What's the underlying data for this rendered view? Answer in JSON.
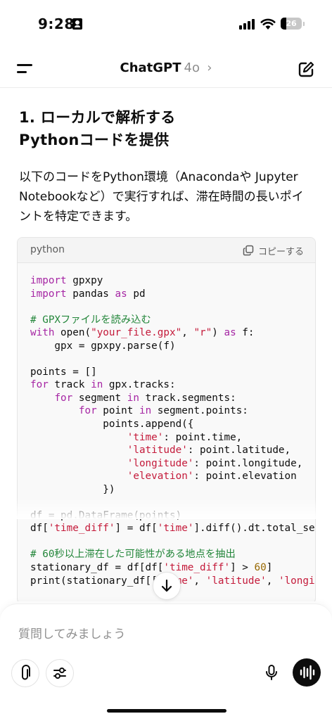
{
  "status": {
    "time": "9:28",
    "battery": "26",
    "battery_level": 0.26
  },
  "header": {
    "title": "ChatGPT",
    "model": "4o",
    "chevron": "›"
  },
  "content": {
    "heading_line1": "1. ローカルで解析する",
    "heading_line2": "Pythonコードを提供",
    "paragraph": "以下のコードをPython環境（Anacondaや Jupyter Notebookなど）で実行すれば、滞在時間の長いポイントを特定できます。",
    "code": {
      "language": "python",
      "copy_label": "コピーする",
      "lines": [
        [
          {
            "t": "import",
            "c": "kw"
          },
          {
            "t": " gpxpy"
          }
        ],
        [
          {
            "t": "import",
            "c": "kw"
          },
          {
            "t": " pandas "
          },
          {
            "t": "as",
            "c": "kw"
          },
          {
            "t": " pd"
          }
        ],
        [],
        [
          {
            "t": "# GPXファイルを読み込む",
            "c": "cm"
          }
        ],
        [
          {
            "t": "with",
            "c": "kw"
          },
          {
            "t": " open("
          },
          {
            "t": "\"your_file.gpx\"",
            "c": "str"
          },
          {
            "t": ", "
          },
          {
            "t": "\"r\"",
            "c": "str"
          },
          {
            "t": ") "
          },
          {
            "t": "as",
            "c": "kw"
          },
          {
            "t": " f:"
          }
        ],
        [
          {
            "t": "    gpx = gpxpy.parse(f)"
          }
        ],
        [],
        [
          {
            "t": "points = []"
          }
        ],
        [
          {
            "t": "for",
            "c": "kw"
          },
          {
            "t": " track "
          },
          {
            "t": "in",
            "c": "kw"
          },
          {
            "t": " gpx.tracks:"
          }
        ],
        [
          {
            "t": "    "
          },
          {
            "t": "for",
            "c": "kw"
          },
          {
            "t": " segment "
          },
          {
            "t": "in",
            "c": "kw"
          },
          {
            "t": " track.segments:"
          }
        ],
        [
          {
            "t": "        "
          },
          {
            "t": "for",
            "c": "kw"
          },
          {
            "t": " point "
          },
          {
            "t": "in",
            "c": "kw"
          },
          {
            "t": " segment.points:"
          }
        ],
        [
          {
            "t": "            points.append({"
          }
        ],
        [
          {
            "t": "                "
          },
          {
            "t": "'time'",
            "c": "str"
          },
          {
            "t": ": point.time,"
          }
        ],
        [
          {
            "t": "                "
          },
          {
            "t": "'latitude'",
            "c": "str"
          },
          {
            "t": ": point.latitude,"
          }
        ],
        [
          {
            "t": "                "
          },
          {
            "t": "'longitude'",
            "c": "str"
          },
          {
            "t": ": point.longitude,"
          }
        ],
        [
          {
            "t": "                "
          },
          {
            "t": "'elevation'",
            "c": "str"
          },
          {
            "t": ": point.elevation"
          }
        ],
        [
          {
            "t": "            })"
          }
        ],
        [],
        [
          {
            "t": "df = pd.DataFrame(points)"
          }
        ],
        [
          {
            "t": "df["
          },
          {
            "t": "'time_diff'",
            "c": "str"
          },
          {
            "t": "] = df["
          },
          {
            "t": "'time'",
            "c": "str"
          },
          {
            "t": "].diff().dt.total_seconds()"
          }
        ],
        [],
        [
          {
            "t": "# 60秒以上滞在した可能性がある地点を抽出",
            "c": "cm"
          }
        ],
        [
          {
            "t": "stationary_df = df[df["
          },
          {
            "t": "'time_diff'",
            "c": "str"
          },
          {
            "t": "] > "
          },
          {
            "t": "60",
            "c": "num"
          },
          {
            "t": "]"
          }
        ],
        [
          {
            "t": "print(stationary_df[["
          },
          {
            "t": "'time'",
            "c": "str"
          },
          {
            "t": ", "
          },
          {
            "t": "'latitude'",
            "c": "str"
          },
          {
            "t": ", "
          },
          {
            "t": "'longitude'",
            "c": "str"
          },
          {
            "t": "]])"
          }
        ]
      ]
    }
  },
  "composer": {
    "placeholder": "質問してみましょう"
  },
  "icons": {
    "menu": "menu-icon",
    "edit": "new-chat-icon",
    "copy": "copy-icon",
    "scroll": "arrow-down-icon",
    "attach": "paperclip-icon",
    "tools": "sliders-icon",
    "mic": "microphone-icon",
    "voice": "voice-mode-icon"
  },
  "colors": {
    "keyword": "#a626a4",
    "string": "#c41a3a",
    "comment": "#23863a",
    "number": "#986801"
  }
}
